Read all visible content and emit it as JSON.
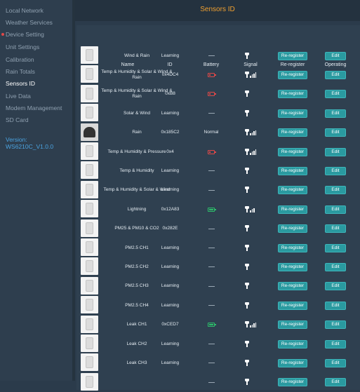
{
  "sidebar": {
    "items": [
      "Local Network",
      "Weather Services",
      "Device Setting",
      "Unit Settings",
      "Calibration",
      "Rain Totals",
      "Sensors ID",
      "Live Data",
      "Modem Management",
      "SD Card"
    ],
    "active_index": 6,
    "version_label": "Version:",
    "version_value": "WS6210C_V1.0.0"
  },
  "header": {
    "title": "Sensors ID"
  },
  "table": {
    "columns": [
      "Name",
      "ID",
      "Battery",
      "Signal",
      "Re-register",
      "Operating"
    ],
    "rows": [
      {
        "name": "Wind & Rain",
        "id": "Learning",
        "battery": "none",
        "signal": "none",
        "rr": "Re-register",
        "op": "Edit",
        "thumb": "white"
      },
      {
        "name": "Temp & Humidity & Solar & Wind & Rain",
        "id": "0x4DC4",
        "battery": "low",
        "signal": "4",
        "rr": "Re-register",
        "op": "Edit",
        "thumb": "white"
      },
      {
        "name": "Temp & Humidity & Solar & Wind & Rain",
        "id": "0xB8",
        "battery": "low",
        "signal": "none",
        "rr": "Re-register",
        "op": "Edit",
        "thumb": "white"
      },
      {
        "name": "Solar & Wind",
        "id": "Learning",
        "battery": "none",
        "signal": "none",
        "rr": "Re-register",
        "op": "Edit",
        "thumb": "white"
      },
      {
        "name": "Rain",
        "id": "0x185C2",
        "battery": "Normal",
        "signal": "4",
        "rr": "Re-register",
        "op": "Edit",
        "thumb": "dark"
      },
      {
        "name": "Temp & Humidity & Pressure",
        "id": "0x4",
        "battery": "low",
        "signal": "4",
        "rr": "Re-register",
        "op": "Edit",
        "thumb": "white"
      },
      {
        "name": "Temp & Humidity",
        "id": "Learning",
        "battery": "none",
        "signal": "none",
        "rr": "Re-register",
        "op": "Edit",
        "thumb": "white"
      },
      {
        "name": "Temp & Humidity & Solar & Wind",
        "id": "Learning",
        "battery": "none",
        "signal": "none",
        "rr": "Re-register",
        "op": "Edit",
        "thumb": "white"
      },
      {
        "name": "Lightning",
        "id": "0x12A83",
        "battery": "ok",
        "signal": "3",
        "rr": "Re-register",
        "op": "Edit",
        "thumb": "white"
      },
      {
        "name": "PM25 & PM10 & CO2",
        "id": "0x282E",
        "battery": "none",
        "signal": "none",
        "rr": "Re-register",
        "op": "Edit",
        "thumb": "white"
      },
      {
        "name": "PM2.5 CH1",
        "id": "Learning",
        "battery": "none",
        "signal": "none",
        "rr": "Re-register",
        "op": "Edit",
        "thumb": "white"
      },
      {
        "name": "PM2.5 CH2",
        "id": "Learning",
        "battery": "none",
        "signal": "none",
        "rr": "Re-register",
        "op": "Edit",
        "thumb": "white"
      },
      {
        "name": "PM2.5 CH3",
        "id": "Learning",
        "battery": "none",
        "signal": "none",
        "rr": "Re-register",
        "op": "Edit",
        "thumb": "white"
      },
      {
        "name": "PM2.5 CH4",
        "id": "Learning",
        "battery": "none",
        "signal": "none",
        "rr": "Re-register",
        "op": "Edit",
        "thumb": "white"
      },
      {
        "name": "Leak CH1",
        "id": "0xCED7",
        "battery": "ok",
        "signal": "4",
        "rr": "Re-register",
        "op": "Edit",
        "thumb": "white"
      },
      {
        "name": "Leak CH2",
        "id": "Learning",
        "battery": "none",
        "signal": "none",
        "rr": "Re-register",
        "op": "Edit",
        "thumb": "white"
      },
      {
        "name": "Leak CH3",
        "id": "Learning",
        "battery": "none",
        "signal": "none",
        "rr": "Re-register",
        "op": "Edit",
        "thumb": "white"
      },
      {
        "name": "",
        "id": "",
        "battery": "none",
        "signal": "none",
        "rr": "Re-register",
        "op": "Edit",
        "thumb": "white"
      }
    ]
  },
  "colors": {
    "title": "#f0a030",
    "button": "#2a9aa0",
    "battery_low": "#e04848",
    "battery_ok": "#2dbd6a",
    "version": "#4aa3e0"
  },
  "icons": {
    "signal": "signal-antenna-icon",
    "battery": "battery-icon",
    "thumbnail": "sensor-thumbnail"
  }
}
